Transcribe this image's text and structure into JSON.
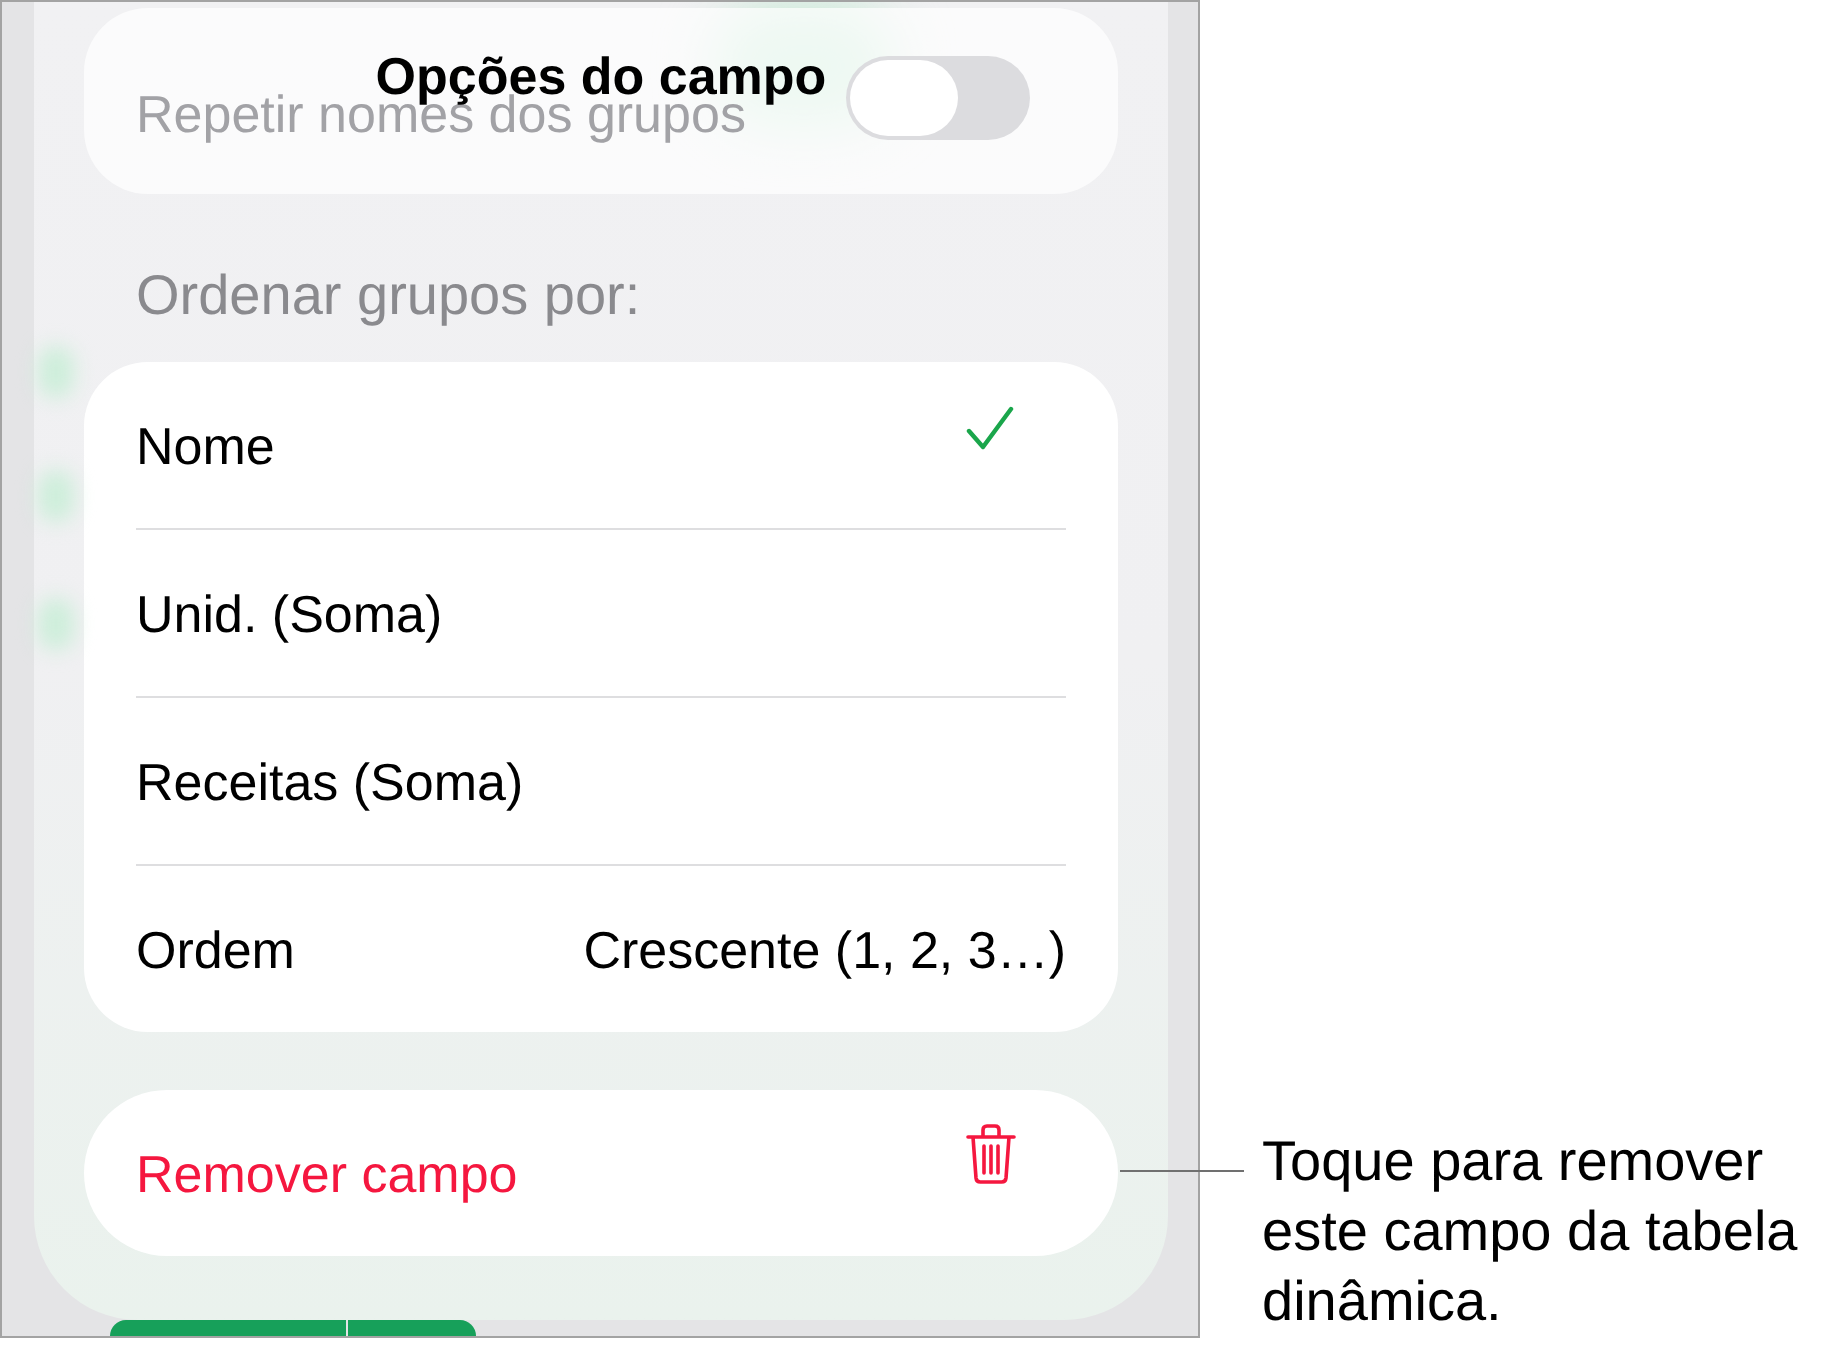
{
  "sheet": {
    "title": "Opções do campo"
  },
  "background_setting": {
    "label": "Repetir nomes dos grupos",
    "on": false
  },
  "sort_section": {
    "header": "Ordenar grupos por:",
    "options": [
      {
        "label": "Nome",
        "selected": true
      },
      {
        "label": "Unid. (Soma)",
        "selected": false
      },
      {
        "label": "Receitas (Soma)",
        "selected": false
      }
    ],
    "order": {
      "label": "Ordem",
      "value": "Crescente (1, 2, 3…)"
    }
  },
  "remove_button": {
    "label": "Remover campo"
  },
  "callout": {
    "text": "Toque para remover este campo da tabela dinâmica."
  }
}
